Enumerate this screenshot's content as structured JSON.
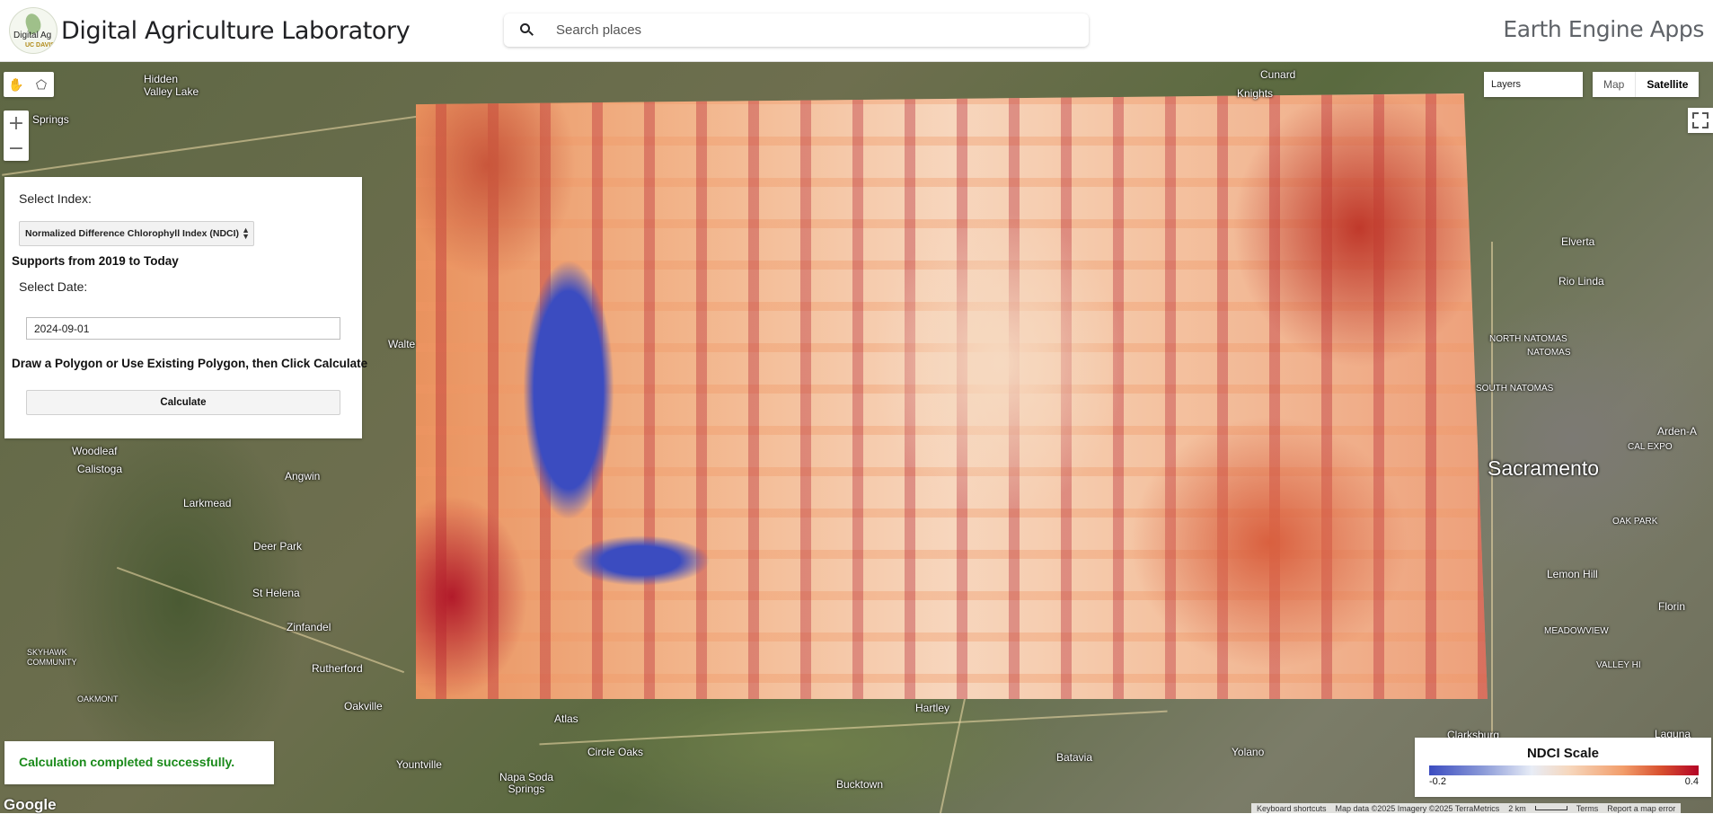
{
  "header": {
    "logo_text": "Digital Ag",
    "logo_subtext": "UC DAVIS",
    "title": "Digital Agriculture Laboratory",
    "search_placeholder": "Search places",
    "right_title": "Earth Engine Apps"
  },
  "map_controls": {
    "draw_tools": [
      "hand-icon",
      "polygon-icon"
    ],
    "zoom_in": "+",
    "zoom_out": "−",
    "layers_label": "Layers",
    "map_type_map": "Map",
    "map_type_satellite": "Satellite"
  },
  "panel": {
    "select_index_label": "Select Index:",
    "index_selected": "Normalized Difference Chlorophyll Index (NDCI)",
    "supports_text": "Supports from 2019 to Today",
    "select_date_label": "Select Date:",
    "date_value": "2024-09-01",
    "instructions": "Draw a Polygon or Use Existing Polygon, then Click Calculate",
    "calculate_label": "Calculate"
  },
  "status": {
    "message": "Calculation completed successfully."
  },
  "legend": {
    "title": "NDCI Scale",
    "min": "-0.2",
    "max": "0.4",
    "colors": [
      "#3b4cc0",
      "#e7ecf6",
      "#f29d6a",
      "#b40426"
    ]
  },
  "map_labels": {
    "hidden_valley_lake": "Hidden\nValley Lake",
    "springs": "Springs",
    "walte": "Walte",
    "woodleaf": "Woodleaf",
    "calistoga": "Calistoga",
    "angwin": "Angwin",
    "larkmead": "Larkmead",
    "deer_park": "Deer Park",
    "st_helena": "St Helena",
    "zinfandel": "Zinfandel",
    "skyhawk": "SKYHAWK\nCOMMUNITY",
    "rutherford": "Rutherford",
    "oakmont": "OAKMONT",
    "oakville": "Oakville",
    "yountville": "Yountville",
    "atlas": "Atlas",
    "circle_oaks": "Circle Oaks",
    "napa_soda_springs": "Napa Soda\nSprings",
    "bucktown": "Bucktown",
    "hartley": "Hartley",
    "batavia": "Batavia",
    "yolano": "Yolano",
    "cunard": "Cunard",
    "knights": "Knights",
    "elverta": "Elverta",
    "rio_linda": "Rio Linda",
    "north_natomas": "NORTH NATOMAS",
    "natomas": "NATOMAS",
    "south_natomas": "SOUTH NATOMAS",
    "sacramento": "Sacramento",
    "lemon_hill": "Lemon Hill",
    "florin": "Florin",
    "meadowview": "MEADOWVIEW",
    "valley_hi": "VALLEY HI",
    "laguna": "Laguna",
    "clarksburg": "Clarksburg",
    "oak_park": "OAK PARK",
    "arden": "Arden-A",
    "cal_expo": "CAL EXPO"
  },
  "footer": {
    "google": "Google",
    "keyboard_shortcuts": "Keyboard shortcuts",
    "map_data": "Map data ©2025 Imagery ©2025 TerraMetrics",
    "scale": "2 km",
    "terms": "Terms",
    "report": "Report a map error"
  }
}
